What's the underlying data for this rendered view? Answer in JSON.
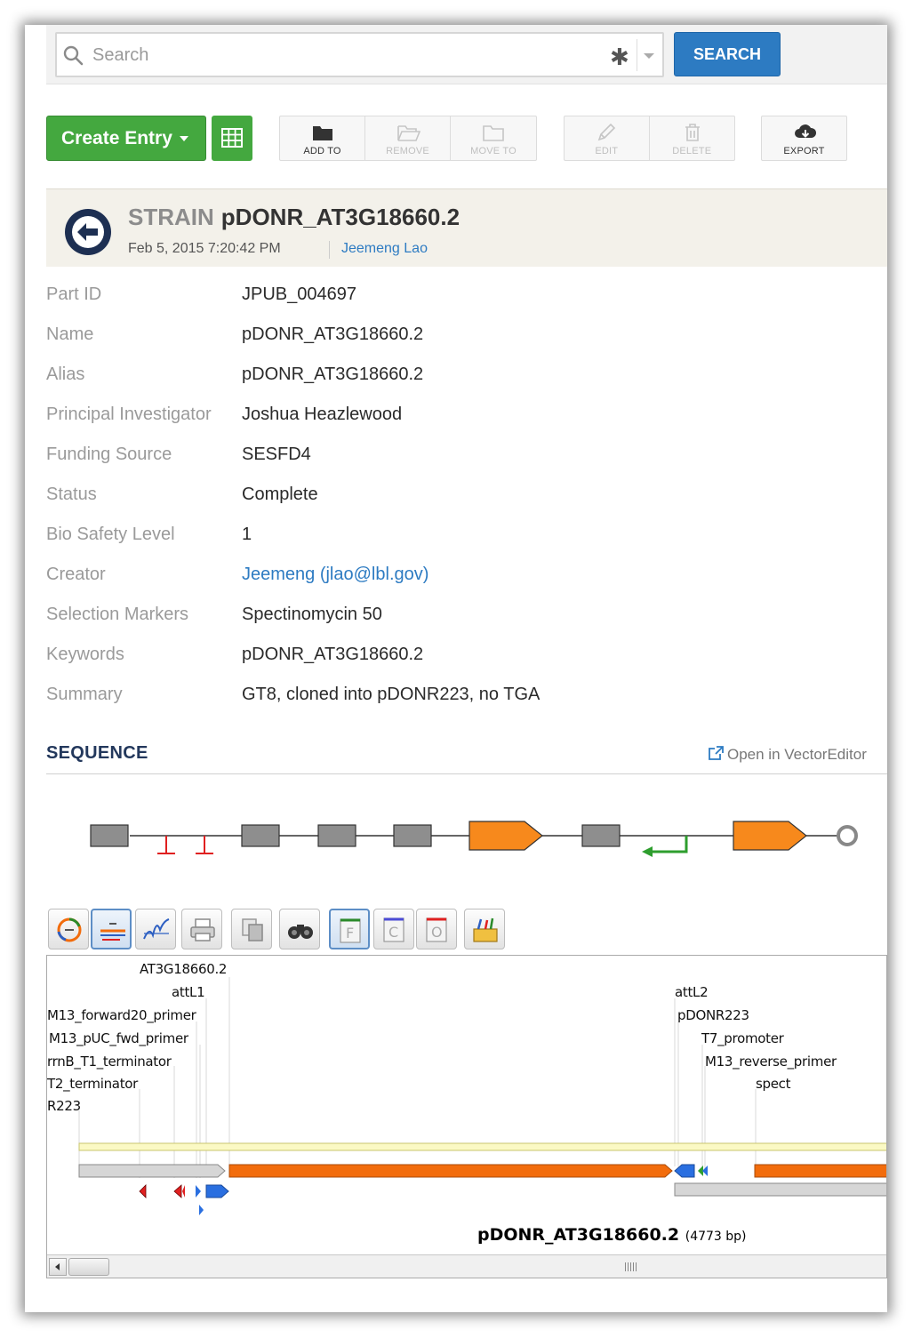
{
  "search": {
    "placeholder": "Search",
    "button_label": "SEARCH"
  },
  "toolbar": {
    "create_label": "Create Entry",
    "actions": [
      {
        "label": "ADD TO",
        "icon": "folder-icon",
        "enabled": true
      },
      {
        "label": "REMOVE",
        "icon": "folder-open-icon",
        "enabled": false
      },
      {
        "label": "MOVE TO",
        "icon": "folder-outline-icon",
        "enabled": false
      },
      {
        "label": "EDIT",
        "icon": "pencil-icon",
        "enabled": false
      },
      {
        "label": "DELETE",
        "icon": "trash-icon",
        "enabled": false
      },
      {
        "label": "EXPORT",
        "icon": "cloud-download-icon",
        "enabled": true
      }
    ]
  },
  "entry": {
    "type": "STRAIN",
    "name": "pDONR_AT3G18660.2",
    "date": "Feb 5, 2015 7:20:42 PM",
    "owner": "Jeemeng Lao"
  },
  "fields": [
    {
      "label": "Part ID",
      "value": "JPUB_004697"
    },
    {
      "label": "Name",
      "value": "pDONR_AT3G18660.2"
    },
    {
      "label": "Alias",
      "value": "pDONR_AT3G18660.2"
    },
    {
      "label": "Principal Investigator",
      "value": "Joshua Heazlewood"
    },
    {
      "label": "Funding Source",
      "value": "SESFD4"
    },
    {
      "label": "Status",
      "value": "Complete"
    },
    {
      "label": "Bio Safety Level",
      "value": "1"
    },
    {
      "label": "Creator",
      "value": "Jeemeng (jlao@lbl.gov)"
    },
    {
      "label": "Selection Markers",
      "value": "Spectinomycin 50"
    },
    {
      "label": "Keywords",
      "value": "pDONR_AT3G18660.2"
    },
    {
      "label": "Summary",
      "value": "GT8, cloned into pDONR223, no TGA"
    }
  ],
  "sequence": {
    "title": "SEQUENCE",
    "open_link": "Open in VectorEditor",
    "feature_labels": [
      "AT3G18660.2",
      "attL1",
      "M13_forward20_primer",
      "M13_pUC_fwd_primer",
      "rrnB_T1_terminator",
      "T2_terminator",
      "R223",
      "attL2",
      "pDONR223",
      "T7_promoter",
      "M13_reverse_primer",
      "spect"
    ],
    "map_name": "pDONR_AT3G18660.2",
    "map_length": "(4773 bp)"
  },
  "colors": {
    "primary_blue": "#2d7bc2",
    "create_green": "#44a83f",
    "cds_orange": "#f26c0c",
    "terminator_red": "#e02020",
    "promoter_green": "#2e9e2e",
    "header_navy": "#23385c"
  }
}
